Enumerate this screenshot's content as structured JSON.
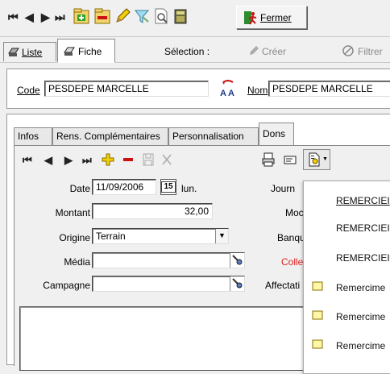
{
  "toolbar": {
    "close_label": "Fermer"
  },
  "topnav": {
    "list_tab": "Liste",
    "card_tab": "Fiche",
    "selection_label": "Sélection :",
    "create_label": "Créer",
    "filter_label": "Filtrer"
  },
  "header": {
    "code_label": "Code",
    "code_value": "PESDEPE MARCELLE",
    "name_label": "Nom",
    "name_value": "PESDEPE MARCELLE"
  },
  "tabs": [
    {
      "label": "Infos"
    },
    {
      "label": "Rens. Complémentaires"
    },
    {
      "label": "Personnalisation"
    },
    {
      "label": "Dons"
    }
  ],
  "form": {
    "date_label": "Date",
    "date_value": "11/09/2006",
    "date_day": "lun.",
    "amount_label": "Montant",
    "amount_value": "32,00",
    "origin_label": "Origine",
    "origin_value": "Terrain",
    "media_label": "Média",
    "media_value": "",
    "campaign_label": "Campagne",
    "campaign_value": "",
    "journal_label": "Journ",
    "mode_label": "Moc",
    "bank_label": "Banqu",
    "collect_label": "Collec",
    "assign_label": "Affectati"
  },
  "menu": {
    "items": [
      {
        "label": "REMERCIEI"
      },
      {
        "label": "REMERCIEI"
      },
      {
        "label": "REMERCIEI"
      },
      {
        "label": "Remercime"
      },
      {
        "label": "Remercime"
      },
      {
        "label": "Remercime"
      }
    ]
  },
  "colors": {
    "collect_label": "#e02020",
    "accent_green": "#2fa52f",
    "accent_red": "#cc1111",
    "accent_yellow": "#f2d000"
  }
}
